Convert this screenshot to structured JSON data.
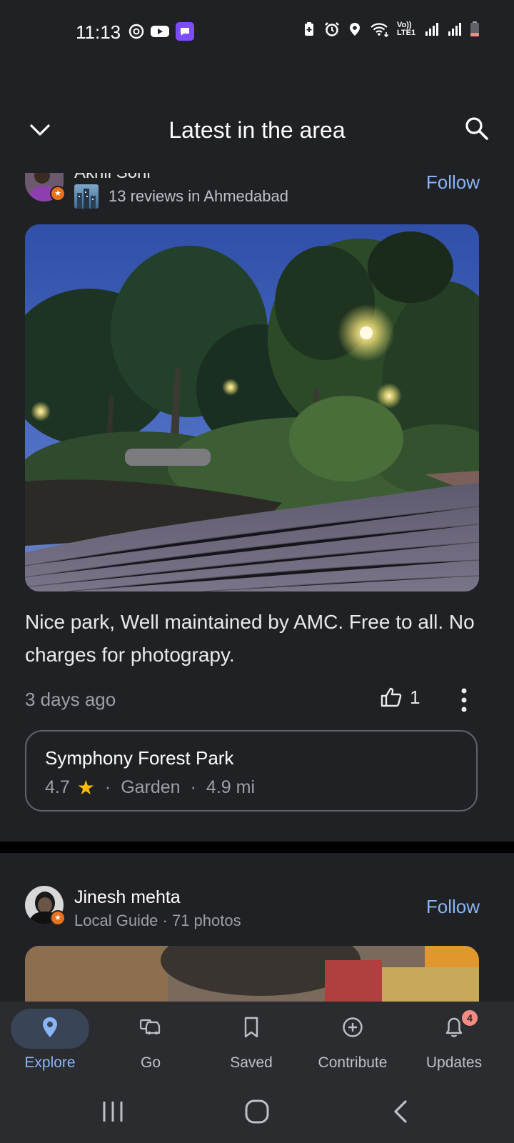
{
  "status_bar": {
    "time": "11:13",
    "left_icons": [
      "threads-icon",
      "youtube-icon",
      "message-icon"
    ],
    "right_icons": [
      "battery-saver-icon",
      "alarm-icon",
      "location-icon",
      "wifi-icon",
      "volte-icon",
      "signal-icon",
      "signal-icon",
      "battery-low-icon"
    ],
    "volte_label": "Vo)) LTE1"
  },
  "header": {
    "title": "Latest in the area"
  },
  "feed": {
    "post1": {
      "author_name": "Akhil Soni",
      "reviews_text": "13 reviews in Ahmedabad",
      "follow_label": "Follow",
      "review_text": "Nice park, Well maintained by AMC. Free to all. No charges for photograpy.",
      "time_ago": "3 days ago",
      "like_count": "1",
      "place": {
        "name": "Symphony Forest Park",
        "rating": "4.7",
        "category": "Garden",
        "distance": "4.9 mi",
        "separator": "·"
      }
    },
    "post2": {
      "author_name": "Jinesh mehta",
      "subtitle": "Local Guide · 71 photos",
      "follow_label": "Follow"
    }
  },
  "bottom_nav": {
    "items": [
      {
        "label": "Explore",
        "icon": "location-pin-icon",
        "active": true
      },
      {
        "label": "Go",
        "icon": "car-icon",
        "active": false
      },
      {
        "label": "Saved",
        "icon": "bookmark-icon",
        "active": false
      },
      {
        "label": "Contribute",
        "icon": "add-circle-icon",
        "active": false
      },
      {
        "label": "Updates",
        "icon": "bell-icon",
        "active": false,
        "badge": "4"
      }
    ]
  },
  "colors": {
    "background": "#202124",
    "accent": "#8ab4f8",
    "active_pill": "#394457",
    "star": "#fbbc04",
    "badge": "#f28b82"
  }
}
